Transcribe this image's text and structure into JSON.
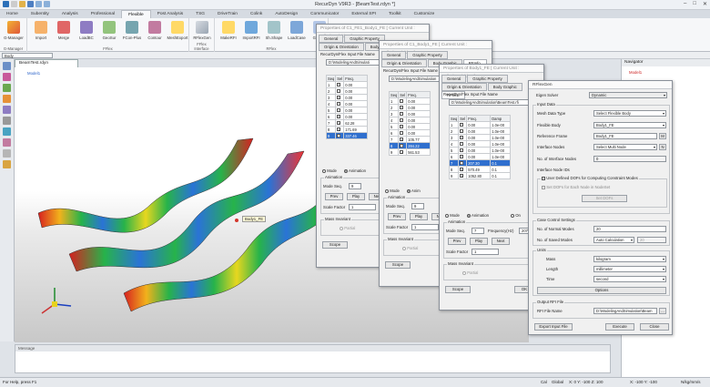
{
  "app": {
    "title": "RecurDyn V9R3 - [BeamTest.rdyn *]",
    "tabs": [
      "Home",
      "Subentity",
      "Analysis",
      "Professional",
      "Flexible",
      "Post Analysis",
      "TSG",
      "DriveTrain",
      "Colink",
      "AutoDesign",
      "Communicator",
      "External SPI",
      "Toolkit",
      "Customize"
    ],
    "active_tab": "Flexible"
  },
  "ribbon": {
    "groups": [
      {
        "label": "G-Manager",
        "buttons": [
          "G-Manager"
        ]
      },
      {
        "label": "FFlex",
        "buttons": [
          "Import",
          "Merge",
          "LoadBC",
          "GeoSur",
          "FCon-Plus",
          "Contour",
          "MeshExport"
        ]
      },
      {
        "label": "FFlex Interface",
        "buttons": [
          "RFlexGen"
        ]
      },
      {
        "label": "RFlex",
        "buttons": [
          "MakeRFI",
          "ImportRFI",
          "Sh.Shape",
          "LoadCase",
          "GeoSur"
        ]
      }
    ]
  },
  "toolbar": {
    "combo": "Body"
  },
  "document_tab": "BeamTest.rdyn",
  "viewport": {
    "model_label": "Model1",
    "body_label": "Body1_FE"
  },
  "message_panel": {
    "title": "Message"
  },
  "status": {
    "left": "For Help, press F1",
    "unit1": "Cal",
    "unit2": "Global",
    "coord1": "X: 0 Y: -100 Z: 100",
    "coord2": "X: -100 Y: -100",
    "units": "N/kg/mm/s"
  },
  "navigator": {
    "title": "Navigator",
    "item": "Model1"
  },
  "props1": {
    "caption": "Properties of C1_FE1_Body1_FE [ Current Unit : N/kg/mm/s/deg ]",
    "tabs": [
      "General",
      "Graphic Property",
      "Origin & Orientation",
      "Body Graphic",
      "RFInfo."
    ],
    "file_label": "RecurDyn/Flex Input File Name",
    "file_value": "D:\\ModelingAndSimulati",
    "table_headers": [
      "Seq",
      "Sel",
      "Freq."
    ],
    "rows": [
      {
        "seq": "1",
        "sel": false,
        "freq": "0.00"
      },
      {
        "seq": "2",
        "sel": false,
        "freq": "0.00"
      },
      {
        "seq": "3",
        "sel": false,
        "freq": "0.00"
      },
      {
        "seq": "4",
        "sel": false,
        "freq": "0.00"
      },
      {
        "seq": "5",
        "sel": false,
        "freq": "0.00"
      },
      {
        "seq": "6",
        "sel": false,
        "freq": "0.00"
      },
      {
        "seq": "7",
        "sel": true,
        "freq": "62.28"
      },
      {
        "seq": "8",
        "sel": true,
        "freq": "171.69"
      },
      {
        "seq": "9",
        "sel": true,
        "freq": "337.46"
      }
    ],
    "mode_label": "Mode",
    "anim_label": "Animation",
    "anim_section": "Animation",
    "mode_seq_label": "Mode Seq.",
    "mode_seq_value": "9",
    "buttons": [
      "Prev",
      "Play",
      "Next"
    ],
    "scale_label": "Scale Factor",
    "scale_value": "1",
    "mass_label": "Mass Invariant",
    "partial": "Partial",
    "scope": "Scope"
  },
  "props2": {
    "caption": "Properties of C1_Body1_FE [ Current Unit : N/kg/mm/s/deg ]",
    "tabs": [
      "General",
      "Graphic Property",
      "Origin & Orientation",
      "Body Graphic",
      "RFInfo."
    ],
    "file_label": "RecurDyn/Flex Input File Name",
    "file_value": "D:\\ModelingAndSimulation",
    "table_headers": [
      "Seq",
      "Sel",
      "Freq."
    ],
    "rows": [
      {
        "seq": "1",
        "sel": false,
        "freq": "0.00"
      },
      {
        "seq": "2",
        "sel": false,
        "freq": "0.00"
      },
      {
        "seq": "3",
        "sel": false,
        "freq": "0.00"
      },
      {
        "seq": "4",
        "sel": false,
        "freq": "0.00"
      },
      {
        "seq": "5",
        "sel": false,
        "freq": "0.00"
      },
      {
        "seq": "6",
        "sel": false,
        "freq": "0.00"
      },
      {
        "seq": "7",
        "sel": true,
        "freq": "105.77"
      },
      {
        "seq": "8",
        "sel": true,
        "freq": "284.22"
      },
      {
        "seq": "9",
        "sel": true,
        "freq": "561.53"
      }
    ],
    "mode_label": "Mode",
    "anim_label": "Anim",
    "anim_section": "Animation",
    "mode_seq_label": "Mode Seq.",
    "mode_seq_value": "9",
    "buttons": [
      "Prev",
      "Play",
      "Next"
    ],
    "scale_label": "Scale Factor",
    "scale_value": "1",
    "mass_label": "Mass Invariant",
    "partial": "Partial",
    "scope": "Scope"
  },
  "props3": {
    "caption": "Properties of Body1_FE [ Current Unit : N/kg/mm/s/deg ]",
    "tabs": [
      "General",
      "Graphic Property",
      "Origin & Orientation",
      "Body Graphic",
      "RFInfo."
    ],
    "file_label": "RecurDyn/Flex Input File Name",
    "file_value": "D:\\ModelingAndSimulation\\BeamTest.rfi",
    "table_headers": [
      "Seq",
      "Sel",
      "Freq.",
      "Damp"
    ],
    "rows": [
      {
        "seq": "1",
        "sel": false,
        "freq": "0.00",
        "damp": "1.0e-00"
      },
      {
        "seq": "2",
        "sel": false,
        "freq": "0.00",
        "damp": "1.0e-00"
      },
      {
        "seq": "3",
        "sel": false,
        "freq": "0.00",
        "damp": "1.0e-00"
      },
      {
        "seq": "4",
        "sel": false,
        "freq": "0.00",
        "damp": "1.0e-00"
      },
      {
        "seq": "5",
        "sel": false,
        "freq": "0.00",
        "damp": "1.0e-00"
      },
      {
        "seq": "6",
        "sel": false,
        "freq": "0.00",
        "damp": "1.0e-00"
      },
      {
        "seq": "7",
        "sel": true,
        "freq": "207.30",
        "damp": "0.1"
      },
      {
        "seq": "8",
        "sel": true,
        "freq": "570.49",
        "damp": "0.1"
      },
      {
        "seq": "9",
        "sel": true,
        "freq": "1052.80",
        "damp": "0.1"
      }
    ],
    "mode_label": "Mode",
    "anim_label": "Animation",
    "other_label": "On",
    "anim_section": "Animation",
    "mode_seq_label": "Mode Seq.",
    "mode_seq_value": "7",
    "freq_label": "Frequency(Hz)",
    "freq_value": "207.3",
    "buttons": [
      "Prev",
      "Play",
      "Next"
    ],
    "scale_label": "Scale Factor",
    "scale_value": "1",
    "mass_label": "Mass Invariant",
    "partial": "Partial",
    "scope": "Scope",
    "ok": "OK"
  },
  "rflexgen": {
    "caption": "RFlexGen",
    "solver_label": "Eigen Solver",
    "solver_value": "Dynamic",
    "input_data": "Input Data",
    "mesh_label": "Mesh Data Type",
    "mesh_value": "Select Flexible Body",
    "flex_label": "Flexible Body",
    "flex_value": "Body1_FE",
    "ref_label": "Reference Frame",
    "ref_value": "Body1_FE",
    "ref_btn": "M",
    "iface_label": "Interface Nodes",
    "iface_value": "Select Multi Node",
    "iface_btn": "N",
    "nodes_label": "No. of Interface Nodes",
    "nodes_value": "0",
    "ids_label": "Interface Node IDs",
    "user_dof": "User Defined DOFs for Computing Constraint Modes",
    "set_dof": "Set DOFs for Each Node in NodeSet",
    "set_dof_btn": "Set DOFs",
    "case_section": "Case Control Settings",
    "normal_label": "No. of Normal Modes",
    "normal_value": "20",
    "saved_label": "No. of Saved Modes",
    "saved_value": "Auto Calculation",
    "saved_num": "20",
    "units_section": "Units",
    "mass_label": "Mass",
    "mass_value": "kilogram",
    "length_label": "Length",
    "length_value": "millimeter",
    "time_label": "Time",
    "time_value": "second",
    "options_btn": "Options",
    "output_section": "Output RFI File",
    "rfi_label": "RFI File Name",
    "rfi_value": "D:\\ModelingAndSimulation\\Beam",
    "browse": "...",
    "export_btn": "Export Input File",
    "execute_btn": "Execute",
    "close_btn": "Close"
  },
  "colors": {
    "accent": "#2f6fce",
    "ribbon_bg": "#f6f7f9",
    "titlebar": "#eef1f5"
  }
}
